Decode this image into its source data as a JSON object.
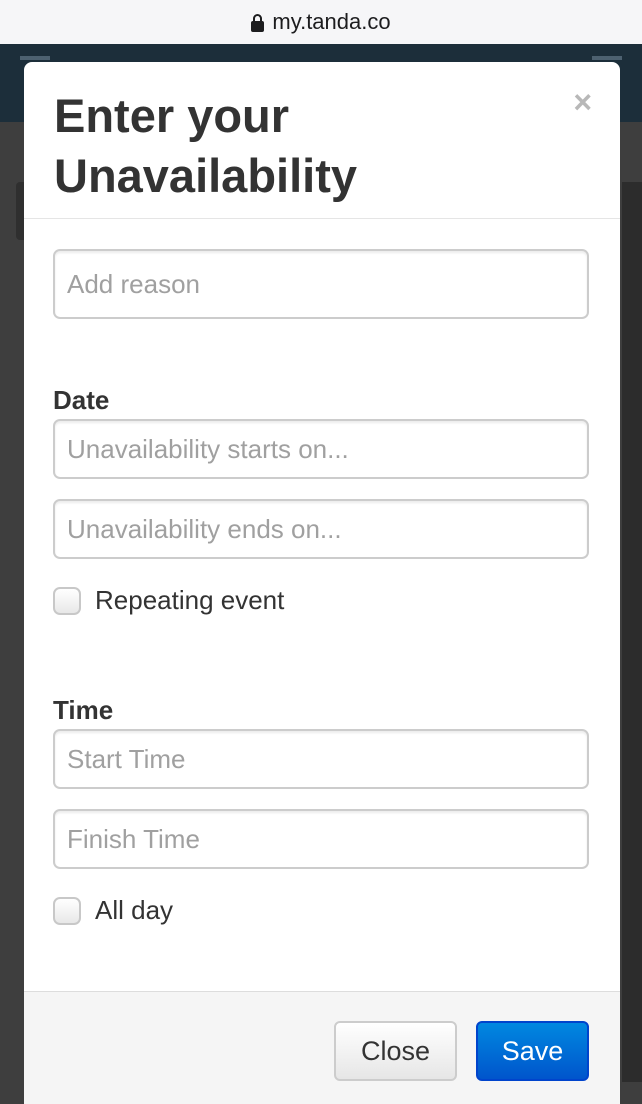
{
  "browser": {
    "url": "my.tanda.co",
    "icons": {
      "lock": "lock-icon"
    }
  },
  "modal": {
    "title": "Enter your Unavailability",
    "close_glyph": "×",
    "reason": {
      "value": "",
      "placeholder": "Add reason"
    },
    "date": {
      "label": "Date",
      "start": {
        "value": "",
        "placeholder": "Unavailability starts on..."
      },
      "end": {
        "value": "",
        "placeholder": "Unavailability ends on..."
      },
      "repeating": {
        "label": "Repeating event",
        "checked": false
      }
    },
    "time": {
      "label": "Time",
      "start": {
        "value": "",
        "placeholder": "Start Time"
      },
      "finish": {
        "value": "",
        "placeholder": "Finish Time"
      },
      "all_day": {
        "label": "All day",
        "checked": false
      }
    },
    "footer": {
      "close_label": "Close",
      "save_label": "Save"
    }
  },
  "colors": {
    "primary": "#0066dd",
    "title_text": "#333333",
    "placeholder": "#a0a0a0"
  }
}
